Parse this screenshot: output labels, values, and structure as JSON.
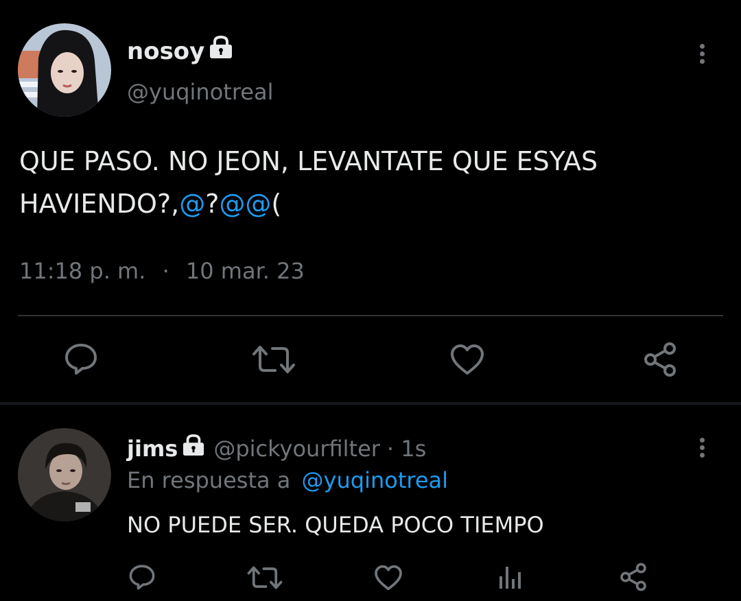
{
  "main_tweet": {
    "display_name": "nosoy",
    "handle": "@yuqinotreal",
    "text_plain": "QUE PASO. NO JEON, LEVANTATE QUE ESYAS HAVIENDO?,",
    "text_link_1": "@",
    "text_mid": "?",
    "text_link_2": "@@",
    "text_end": "(",
    "time": "11:18 p. m.",
    "dot": "·",
    "date": "10 mar. 23",
    "actions": [
      "reply-icon",
      "retweet-icon",
      "like-icon",
      "share-icon"
    ]
  },
  "reply": {
    "display_name": "jims",
    "handle": "@pickyourfilter",
    "age": "· 1s",
    "reply_prefix": "En respuesta a",
    "reply_to": "@yuqinotreal",
    "text": "NO PUEDE SER. QUEDA POCO TIEMPO",
    "actions": [
      "reply-icon",
      "retweet-icon",
      "like-icon",
      "analytics-icon",
      "share-icon"
    ]
  },
  "colors": {
    "background": "#000000",
    "text": "#e7e9ea",
    "muted": "#71767b",
    "link": "#1d9bf0"
  }
}
